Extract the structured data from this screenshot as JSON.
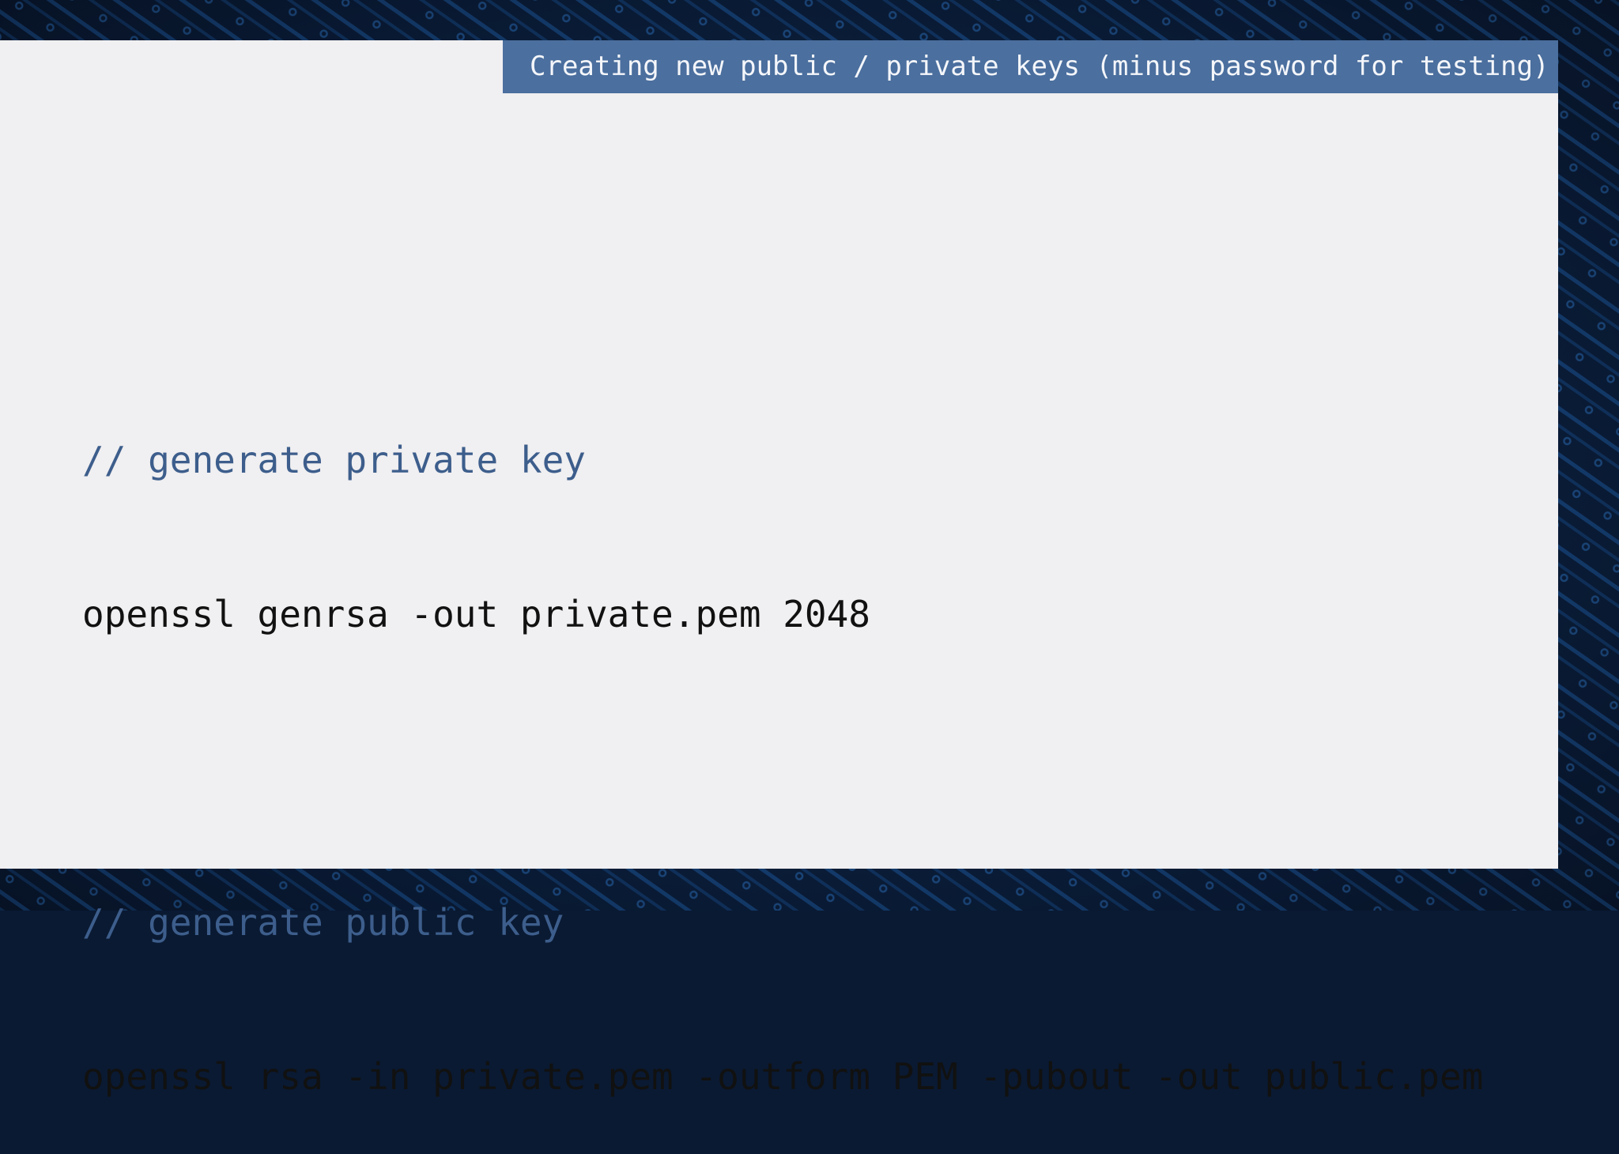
{
  "slide": {
    "title": "Creating new public / private keys (minus password for testing)",
    "blocks": [
      {
        "comment": "// generate private key",
        "command": "openssl genrsa -out private.pem 2048"
      },
      {
        "comment": "// generate public key",
        "command": "openssl rsa -in private.pem -outform PEM -pubout -out public.pem"
      }
    ]
  },
  "colors": {
    "background": "#0a1a33",
    "circuit": "#1f5fa8",
    "panel": "#f0eff1",
    "title_bar": "#4b6f9e",
    "comment": "#3d5e8c",
    "command": "#111111"
  }
}
